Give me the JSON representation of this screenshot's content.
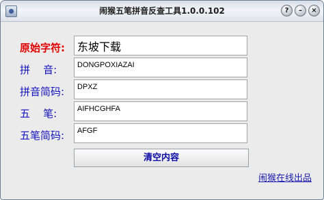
{
  "window": {
    "title": "闹猴五笔拼音反查工具1.0.0.102",
    "controls": {
      "help": "?",
      "minimize": "–",
      "close": "×"
    }
  },
  "form": {
    "original_label": "原始字符:",
    "original_value": "东坡下载",
    "pinyin_label": "拼    音:",
    "pinyin_value": "DONGPOXIAZAI",
    "pinyin_short_label": "拼音简码:",
    "pinyin_short_value": "DPXZ",
    "wubi_label": "五    笔:",
    "wubi_value": "AIFHCGHFA",
    "wubi_short_label": "五笔简码:",
    "wubi_short_value": "AFGF"
  },
  "actions": {
    "clear_label": "清空内容"
  },
  "footer": {
    "link_label": "闹猴在线出品"
  }
}
